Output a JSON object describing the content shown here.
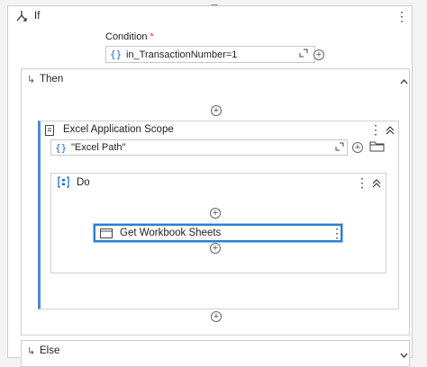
{
  "if_block": {
    "title": "If",
    "condition_label": "Condition",
    "required_marker": "*",
    "condition_value": "in_TransactionNumber=1"
  },
  "then_block": {
    "title": "Then"
  },
  "excel_scope": {
    "title": "Excel Application Scope",
    "path_value": "\"Excel Path\""
  },
  "do_block": {
    "title": "Do"
  },
  "activity": {
    "title": "Get Workbook Sheets"
  },
  "else_block": {
    "title": "Else"
  },
  "icons": {
    "kebab": "⋮",
    "chevron_up": "︿",
    "chevron_down": "﹀",
    "double_chevron_up": "«",
    "plus": "+",
    "expand": "⤢",
    "brace": "{}"
  },
  "colors": {
    "accent_blue": "#1f6fd1",
    "selection_blue": "#2d7dd2",
    "scope_bar": "#4a8bd6"
  }
}
